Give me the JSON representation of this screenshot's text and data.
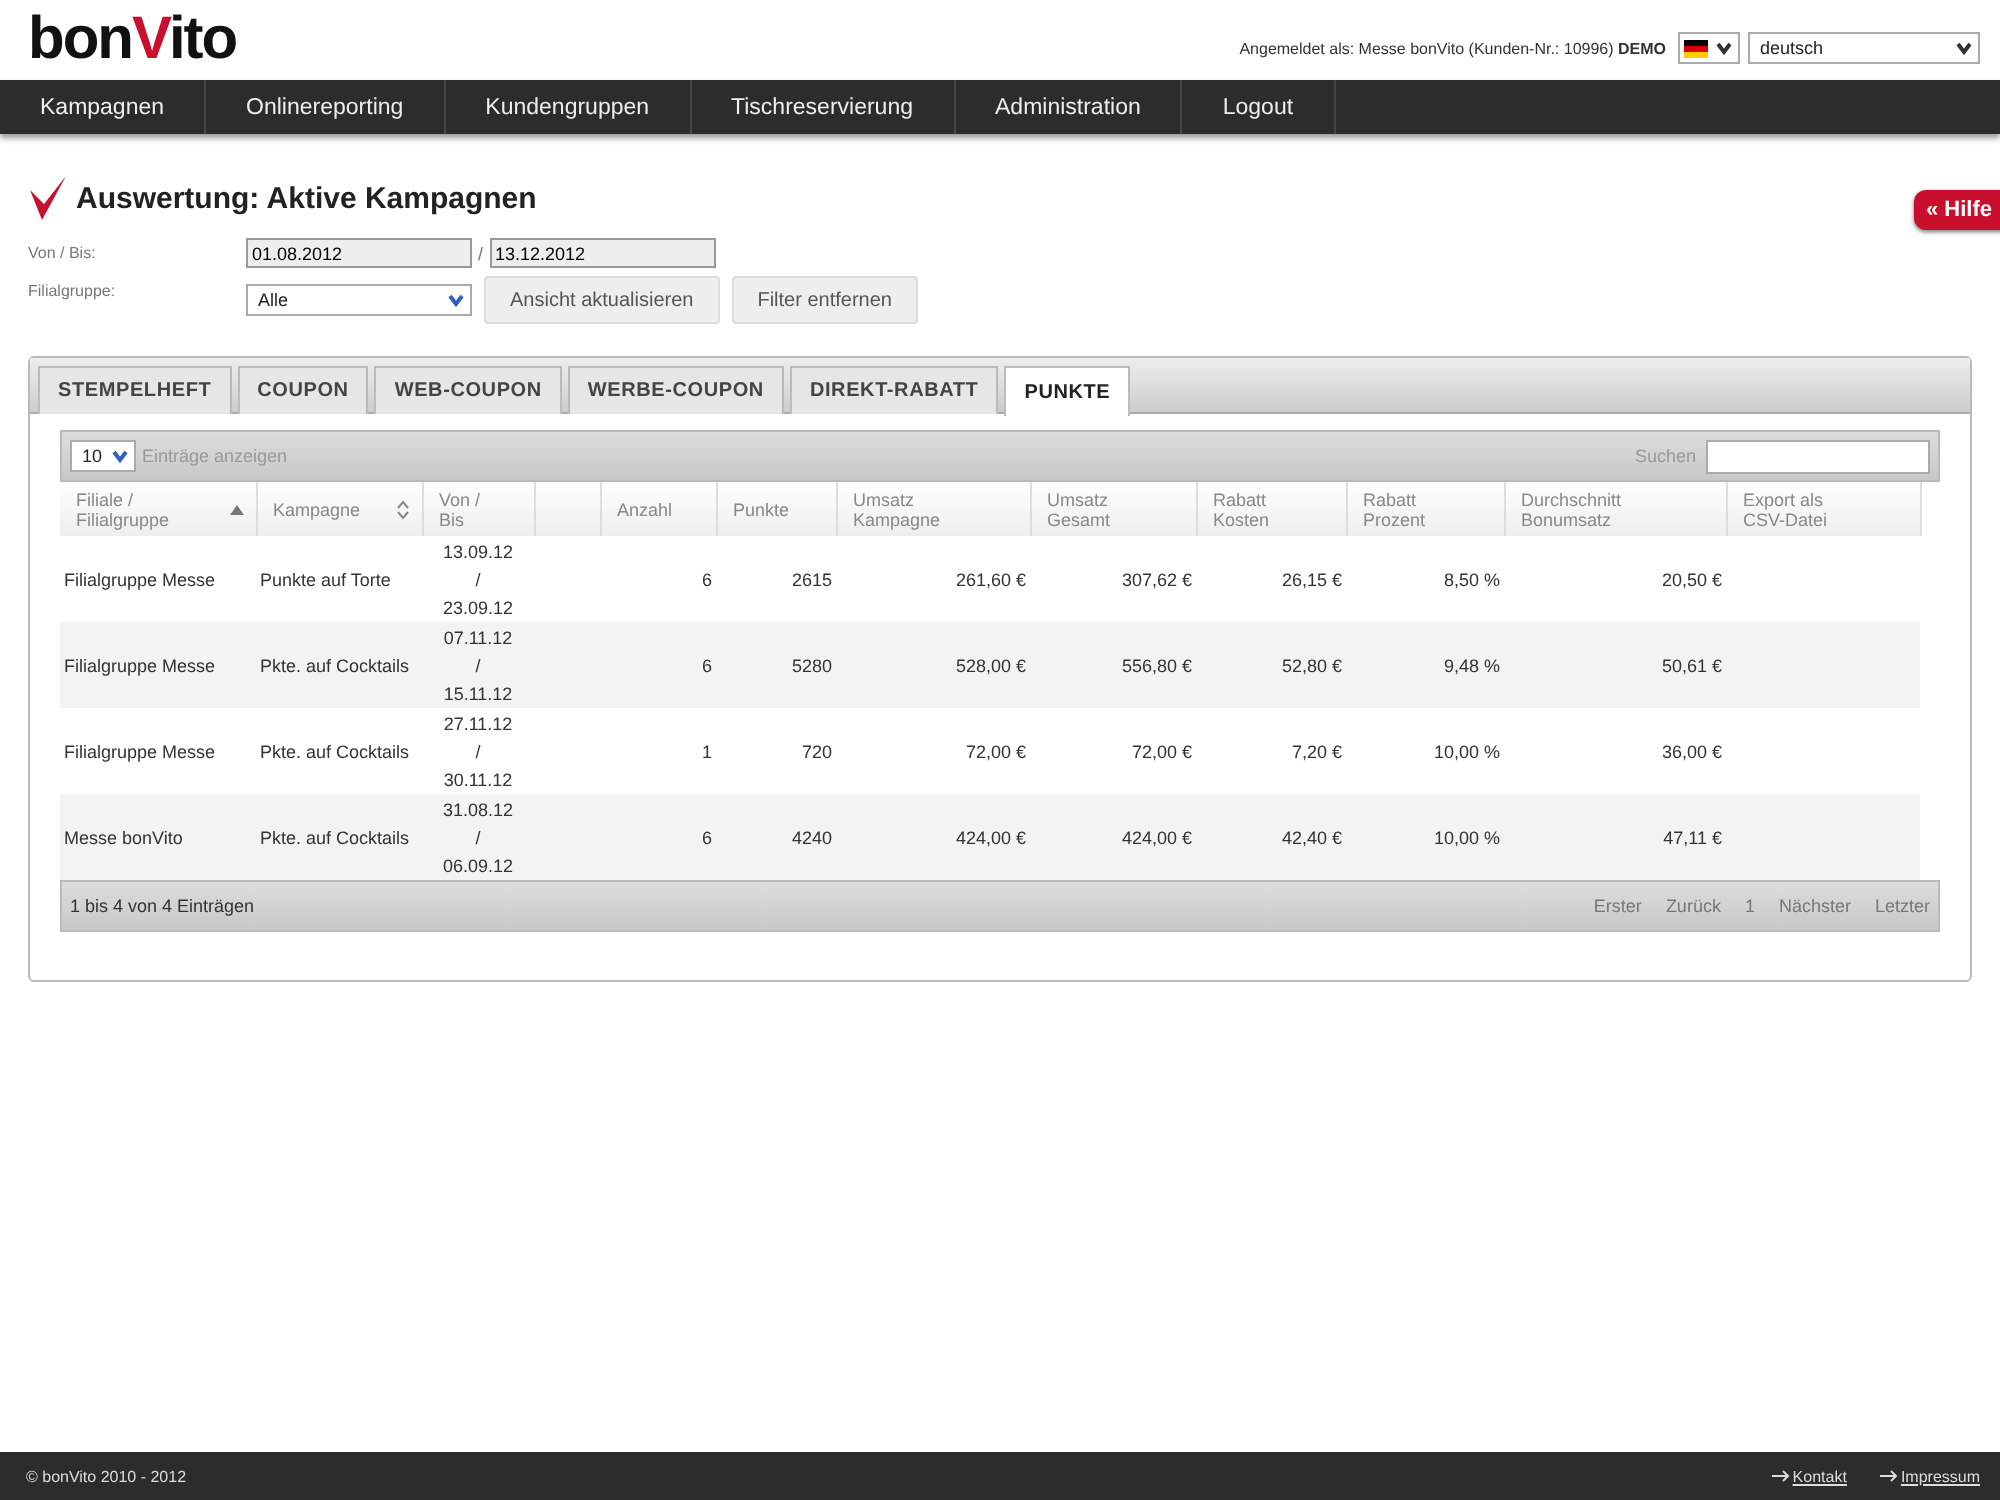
{
  "logo": {
    "before": "bon",
    "accent": "V",
    "after": "ito"
  },
  "login_info": "Angemeldet als: Messe bonVito (Kunden-Nr.: 10996) **DEMO**",
  "language": {
    "value": "deutsch"
  },
  "nav": [
    {
      "label": "Kampagnen"
    },
    {
      "label": "Onlinereporting"
    },
    {
      "label": "Kundengruppen"
    },
    {
      "label": "Tischreservierung"
    },
    {
      "label": "Administration"
    },
    {
      "label": "Logout"
    }
  ],
  "page_title": "Auswertung: Aktive Kampagnen",
  "help_button": "« Hilfe",
  "filters": {
    "date_label": "Von / Bis:",
    "from": "01.08.2012",
    "separator": "/",
    "to": "13.12.2012",
    "group_label": "Filialgruppe:",
    "group_value": "Alle",
    "buttons": [
      "Ansicht aktualisieren",
      "Filter entfernen"
    ]
  },
  "tabs": [
    {
      "label": "STEMPELHEFT",
      "selected": false
    },
    {
      "label": "COUPON",
      "selected": false
    },
    {
      "label": "WEB-COUPON",
      "selected": false
    },
    {
      "label": "WERBE-COUPON",
      "selected": false
    },
    {
      "label": "DIREKT-RABATT",
      "selected": false
    },
    {
      "label": "PUNKTE",
      "selected": true
    }
  ],
  "table_controls": {
    "page_size": "10",
    "page_size_label": "Einträge anzeigen",
    "search_label": "Suchen"
  },
  "table": {
    "columns": [
      {
        "label": "Filiale /\nFilialgruppe",
        "sorted": true
      },
      {
        "label": "Kampagne",
        "sorted": false
      },
      {
        "label": "Von /\nBis"
      },
      {},
      {
        "label": "Anzahl"
      },
      {
        "label": "Punkte"
      },
      {
        "label": "Umsatz\nKampagne"
      },
      {
        "label": "Umsatz\nGesamt"
      },
      {
        "label": "Rabatt\nKosten"
      },
      {
        "label": "Rabatt\nProzent"
      },
      {
        "label": "Durchschnitt\nBonumsatz"
      },
      {
        "label": "Export als\nCSV-Datei"
      }
    ],
    "rows": [
      {
        "cells": [
          "Filialgruppe Messe",
          "Punkte auf Torte",
          "13.09.12\n/\n23.09.12",
          "",
          "6",
          "2615",
          "261,60 €",
          "307,62 €",
          "26,15 €",
          "8,50 %",
          "20,50 €",
          ""
        ]
      },
      {
        "cells": [
          "Filialgruppe Messe",
          "Pkte. auf Cocktails",
          "07.11.12\n/\n15.11.12",
          "",
          "6",
          "5280",
          "528,00 €",
          "556,80 €",
          "52,80 €",
          "9,48 %",
          "50,61 €",
          ""
        ]
      },
      {
        "cells": [
          "Filialgruppe Messe",
          "Pkte. auf Cocktails",
          "27.11.12\n/\n30.11.12",
          "",
          "1",
          "720",
          "72,00 €",
          "72,00 €",
          "7,20 €",
          "10,00 %",
          "36,00 €",
          ""
        ]
      },
      {
        "cells": [
          "Messe bonVito",
          "Pkte. auf Cocktails",
          "31.08.12\n/\n06.09.12",
          "",
          "6",
          "4240",
          "424,00 €",
          "424,00 €",
          "42,40 €",
          "10,00 %",
          "47,11 €",
          ""
        ]
      }
    ]
  },
  "table_info": "1 bis 4 von 4 Einträgen",
  "pagination": [
    {
      "label": "Erster",
      "disabled": true
    },
    {
      "label": "Zurück",
      "disabled": true
    },
    {
      "label": "1",
      "disabled": true
    },
    {
      "label": "Nächster",
      "disabled": true
    },
    {
      "label": "Letzter",
      "disabled": true
    }
  ],
  "footer": {
    "copyright": "© bonVito 2010 - 2012",
    "links": [
      "Kontakt",
      "Impressum"
    ]
  }
}
